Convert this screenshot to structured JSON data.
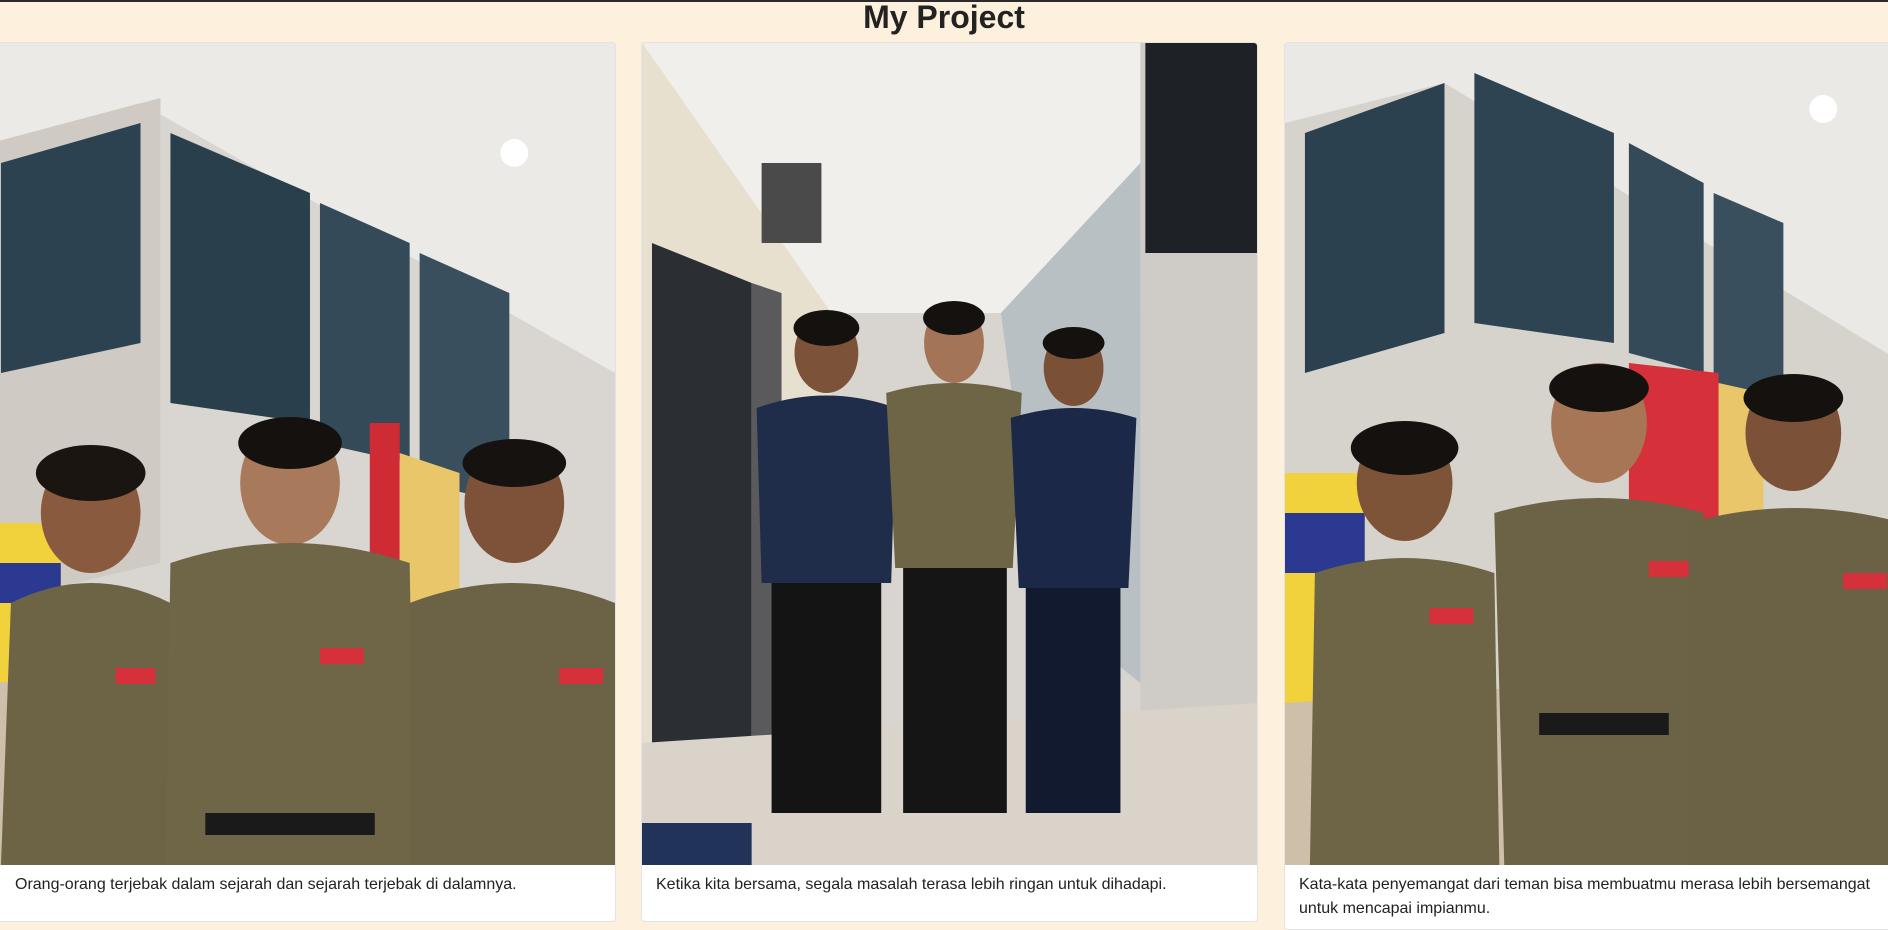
{
  "page": {
    "title": "My Project"
  },
  "cards": [
    {
      "image_alt": "Three young men in brown uniform shirts posing in a hallway",
      "caption": "Orang-orang terjebak dalam sejarah dan sejarah terjebak di dalamnya."
    },
    {
      "image_alt": "Three young men standing with arms crossed in a corridor",
      "caption": "Ketika kita bersama, segala masalah terasa lebih ringan untuk dihadapi."
    },
    {
      "image_alt": "Three young men in brown uniform shirts standing together in a hallway",
      "caption": "Kata-kata penyemangat dari teman bisa membuatmu merasa lebih bersemangat untuk mencapai impianmu."
    }
  ],
  "colors": {
    "background": "#fdf0dc",
    "uniform_brown": "#6e6446",
    "navy_shirt": "#1f2d4a",
    "banner_red": "#d6303a",
    "banner_yellow": "#f4d23a"
  }
}
